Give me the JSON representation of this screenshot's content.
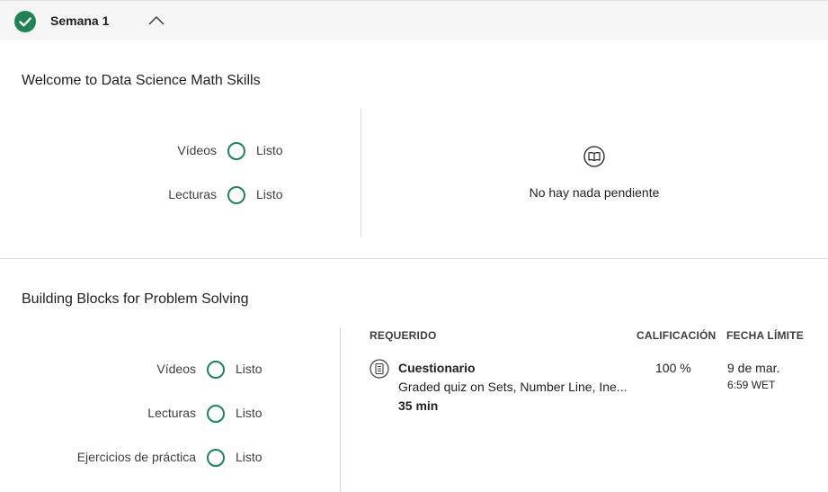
{
  "week": {
    "title": "Semana 1",
    "completed_icon": "check-circle-icon",
    "toggle_icon": "chevron-up-icon",
    "accent_color": "#1f8354"
  },
  "modules": [
    {
      "title": "Welcome to Data Science Math Skills",
      "progress": [
        {
          "label": "Vídeos",
          "status": "Listo"
        },
        {
          "label": "Lecturas",
          "status": "Listo"
        }
      ],
      "pending": {
        "icon": "open-book-icon",
        "message": "No hay nada pendiente"
      }
    },
    {
      "title": "Building Blocks for Problem Solving",
      "progress": [
        {
          "label": "Vídeos",
          "status": "Listo"
        },
        {
          "label": "Lecturas",
          "status": "Listo"
        },
        {
          "label": "Ejercicios de práctica",
          "status": "Listo"
        }
      ],
      "table": {
        "headers": {
          "required": "REQUERIDO",
          "grade": "CALIFICACIÓN",
          "due": "FECHA LÍMITE"
        },
        "items": [
          {
            "icon": "quiz-document-icon",
            "type": "Cuestionario",
            "description": "Graded quiz on Sets, Number Line, Ine...",
            "duration": "35 min",
            "grade": "100 %",
            "due_date": "9 de mar.",
            "due_time": "6:59 WET"
          }
        ]
      }
    }
  ]
}
